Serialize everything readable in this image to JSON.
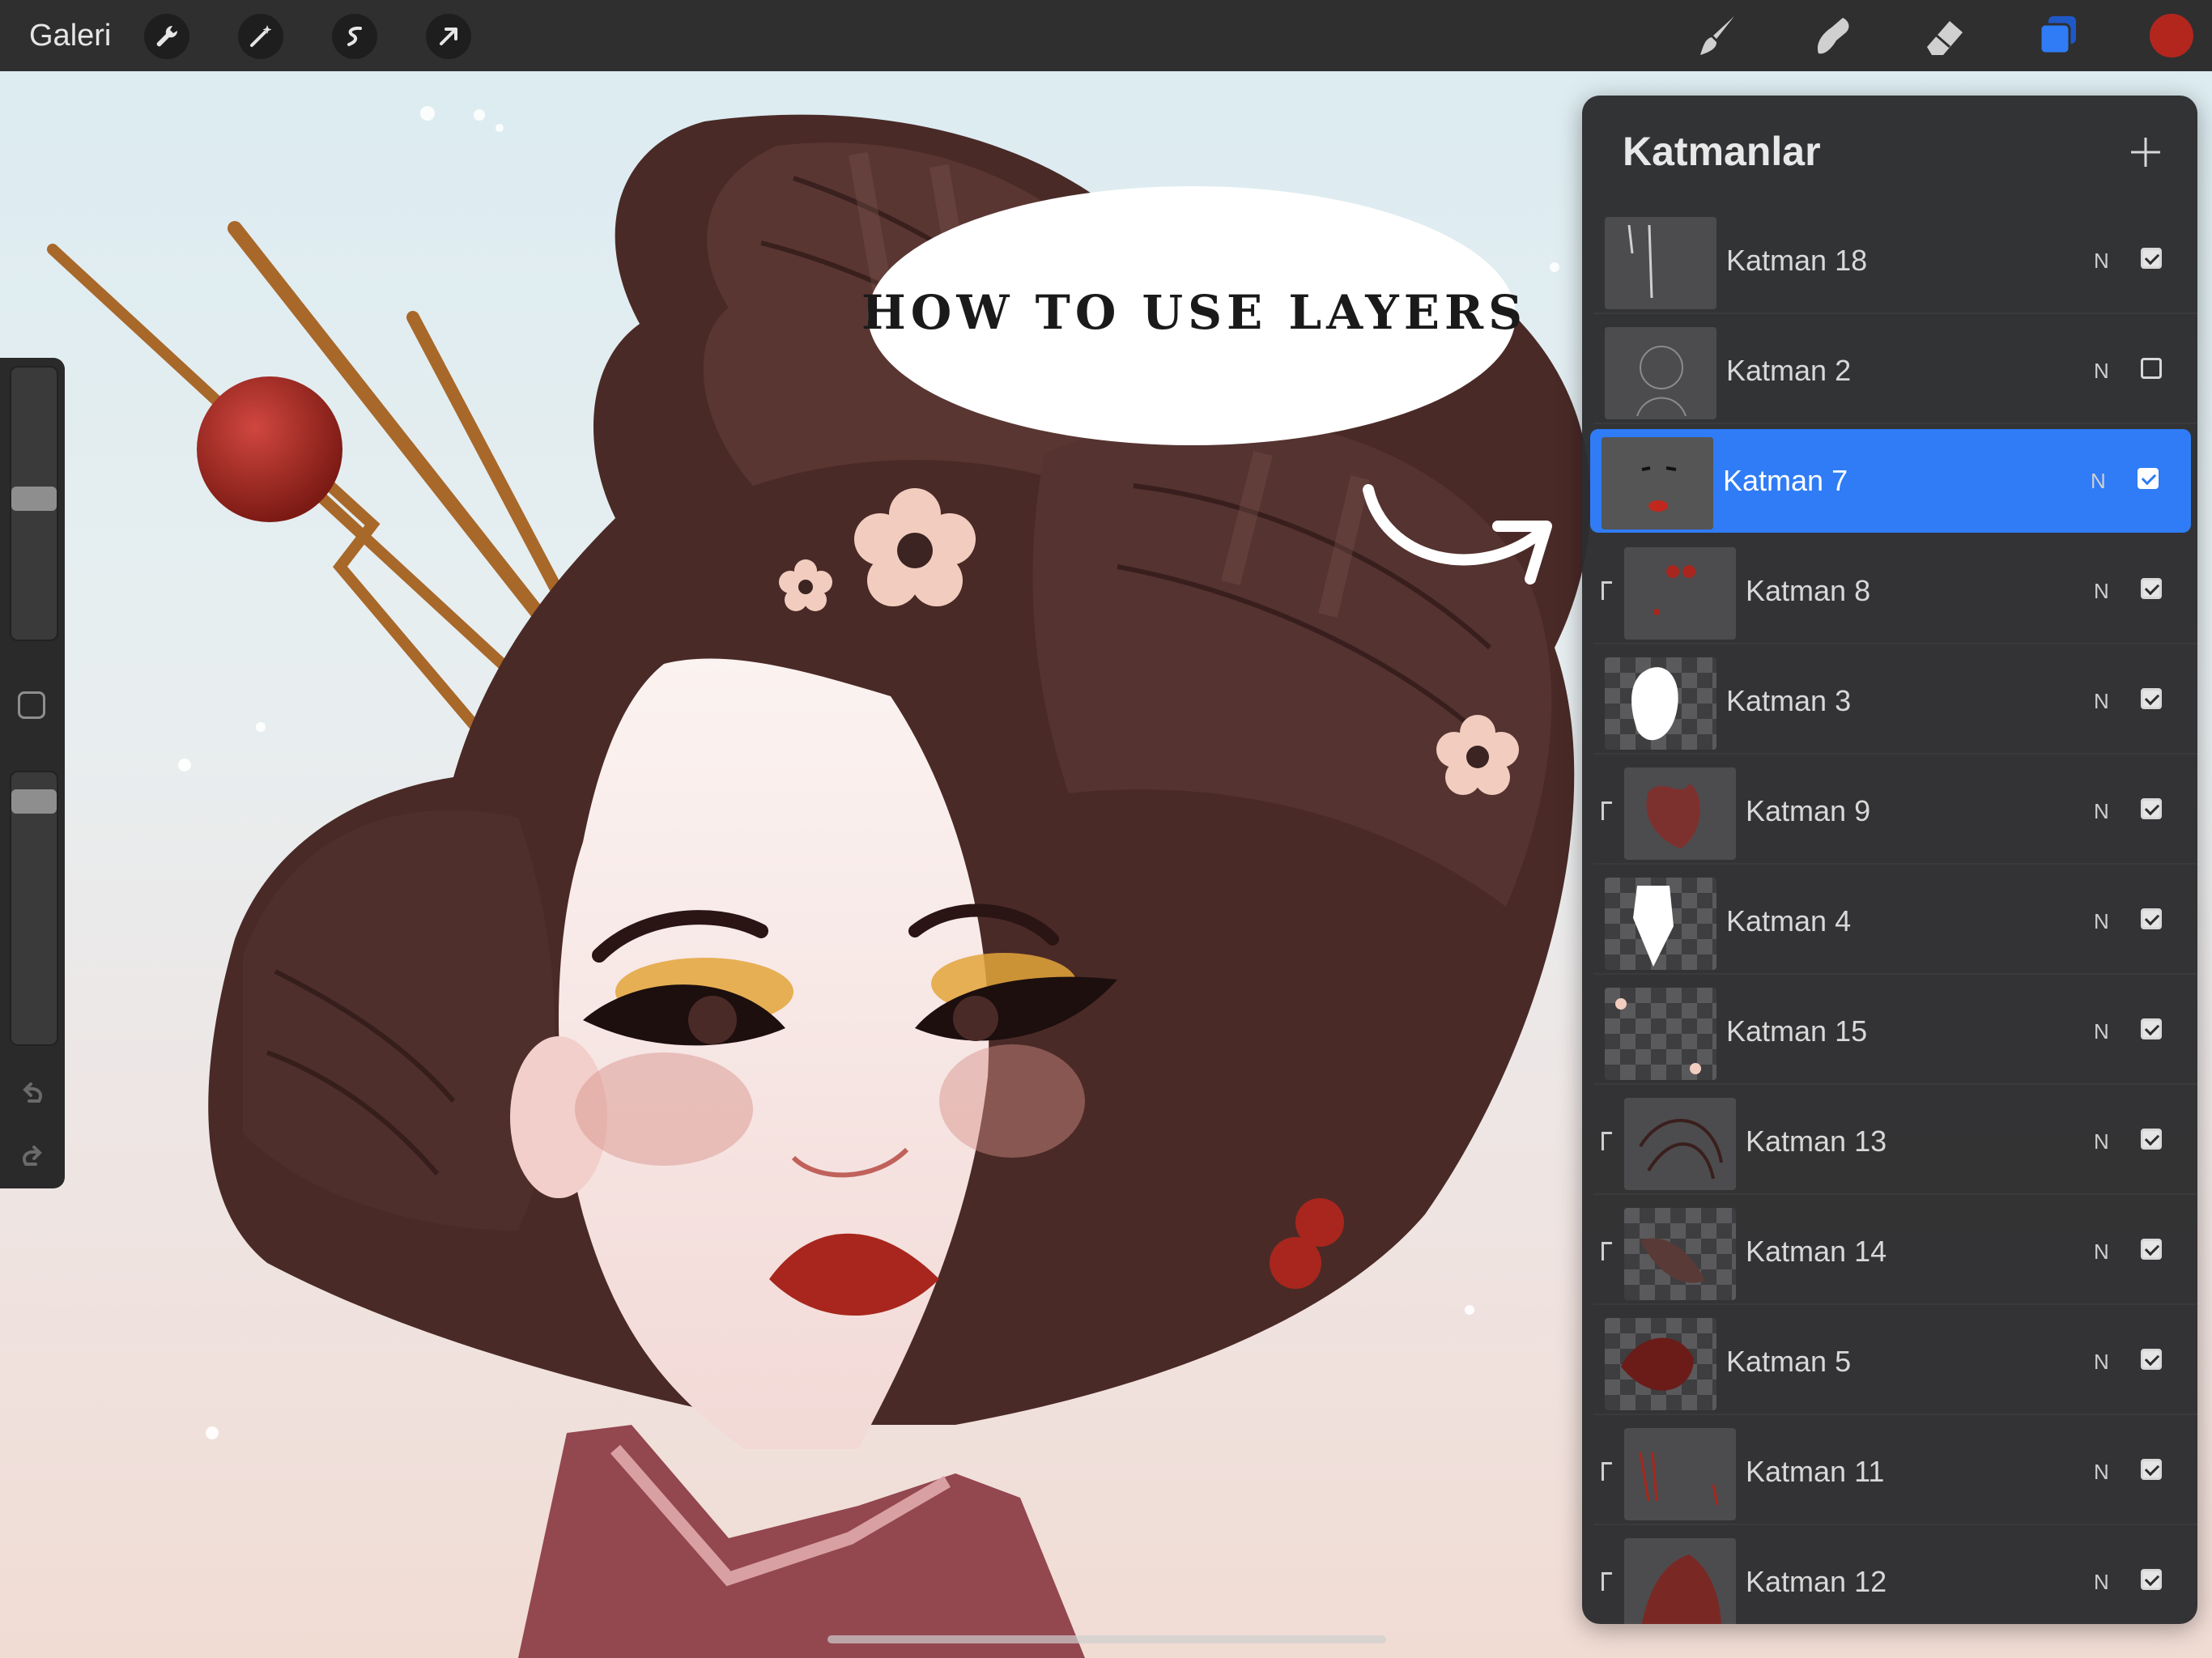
{
  "topbar": {
    "gallery_label": "Galeri",
    "left_tools": [
      "wrench-icon",
      "magic-wand-icon",
      "selection-icon",
      "transform-arrow-icon"
    ],
    "right_tools": [
      "brush-icon",
      "smudge-icon",
      "eraser-icon",
      "layers-icon",
      "color-swatch"
    ],
    "active_color": "#b3261e",
    "layers_icon_color": "#2f7cf6"
  },
  "canvas": {
    "callout_text": "HOW TO USE LAYERS"
  },
  "layers_panel": {
    "title": "Katmanlar",
    "add_icon": "plus-icon",
    "layers": [
      {
        "name": "Katman 18",
        "blend": "N",
        "visible": true,
        "selected": false,
        "clipped": false,
        "thumb": "strands"
      },
      {
        "name": "Katman 2",
        "blend": "N",
        "visible": false,
        "selected": false,
        "clipped": false,
        "thumb": "sketch"
      },
      {
        "name": "Katman 7",
        "blend": "N",
        "visible": true,
        "selected": true,
        "clipped": false,
        "thumb": "face"
      },
      {
        "name": "Katman 8",
        "blend": "N",
        "visible": true,
        "selected": false,
        "clipped": true,
        "thumb": "red-dots"
      },
      {
        "name": "Katman 3",
        "blend": "N",
        "visible": true,
        "selected": false,
        "clipped": false,
        "thumb": "white-shape"
      },
      {
        "name": "Katman 9",
        "blend": "N",
        "visible": true,
        "selected": false,
        "clipped": true,
        "thumb": "red-blush"
      },
      {
        "name": "Katman 4",
        "blend": "N",
        "visible": true,
        "selected": false,
        "clipped": false,
        "thumb": "neck"
      },
      {
        "name": "Katman 15",
        "blend": "N",
        "visible": true,
        "selected": false,
        "clipped": false,
        "thumb": "flowers"
      },
      {
        "name": "Katman 13",
        "blend": "N",
        "visible": true,
        "selected": false,
        "clipped": true,
        "thumb": "hair-lines"
      },
      {
        "name": "Katman 14",
        "blend": "N",
        "visible": true,
        "selected": false,
        "clipped": true,
        "thumb": "hair-shade"
      },
      {
        "name": "Katman 5",
        "blend": "N",
        "visible": true,
        "selected": false,
        "clipped": false,
        "thumb": "dark-red"
      },
      {
        "name": "Katman 11",
        "blend": "N",
        "visible": true,
        "selected": false,
        "clipped": true,
        "thumb": "red-lines"
      },
      {
        "name": "Katman 12",
        "blend": "N",
        "visible": true,
        "selected": false,
        "clipped": true,
        "thumb": "kimono"
      }
    ]
  },
  "sidebar": {
    "brush_size_level": 0.52,
    "opacity_level": 0.93,
    "modify_button": "square-modify-icon",
    "undo_icon": "undo-icon",
    "redo_icon": "redo-icon"
  }
}
